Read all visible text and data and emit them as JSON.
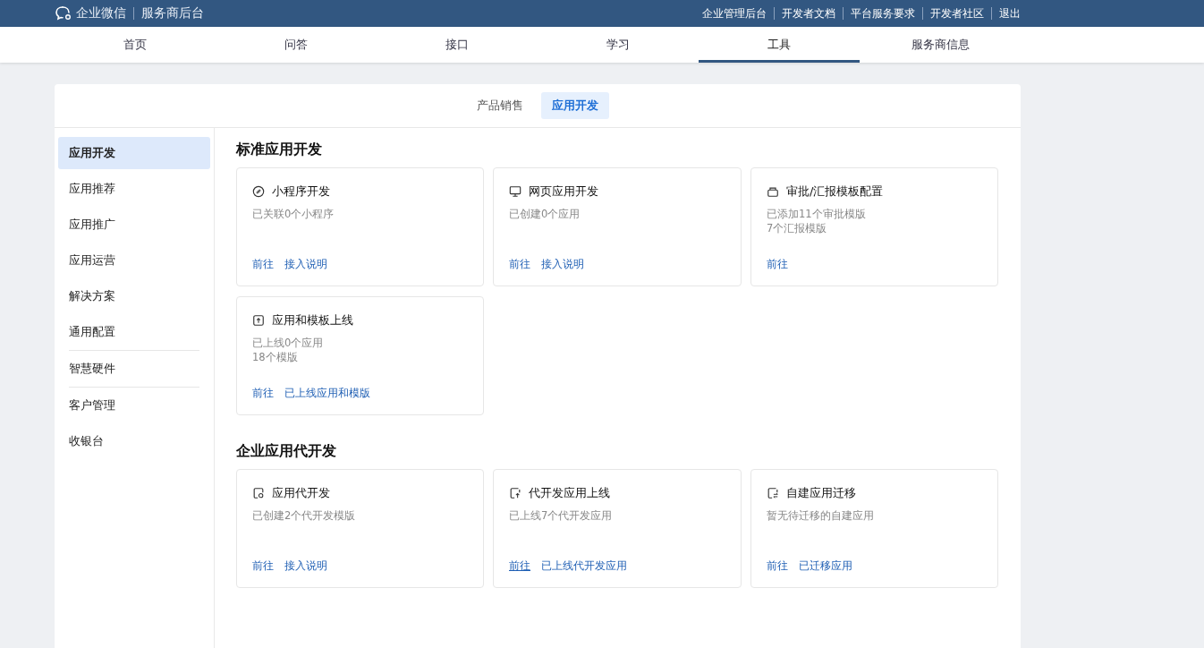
{
  "header": {
    "brand": "企业微信",
    "subtitle": "服务商后台",
    "links": [
      "企业管理后台",
      "开发者文档",
      "平台服务要求",
      "开发者社区",
      "退出"
    ]
  },
  "nav": [
    {
      "label": "首页",
      "selected": false
    },
    {
      "label": "问答",
      "selected": false
    },
    {
      "label": "接口",
      "selected": false
    },
    {
      "label": "学习",
      "selected": false
    },
    {
      "label": "工具",
      "selected": true
    },
    {
      "label": "服务商信息",
      "selected": false
    }
  ],
  "subtabs": [
    {
      "label": "产品销售",
      "selected": false
    },
    {
      "label": "应用开发",
      "selected": true
    }
  ],
  "sidebar": [
    {
      "label": "应用开发",
      "selected": true
    },
    {
      "label": "应用推荐",
      "selected": false
    },
    {
      "label": "应用推广",
      "selected": false
    },
    {
      "label": "应用运营",
      "selected": false
    },
    {
      "label": "解决方案",
      "selected": false
    },
    {
      "label": "通用配置",
      "selected": false
    },
    {
      "label": "智慧硬件",
      "selected": false
    },
    {
      "label": "客户管理",
      "selected": false
    },
    {
      "label": "收银台",
      "selected": false
    }
  ],
  "sections": [
    {
      "title": "标准应用开发",
      "cards": [
        {
          "title": "小程序开发",
          "desc": [
            "已关联0个小程序"
          ],
          "links": [
            {
              "text": "前往",
              "hovered": false
            },
            {
              "text": "接入说明",
              "hovered": false
            }
          ]
        },
        {
          "title": "网页应用开发",
          "desc": [
            "已创建0个应用"
          ],
          "links": [
            {
              "text": "前往",
              "hovered": false
            },
            {
              "text": "接入说明",
              "hovered": false
            }
          ]
        },
        {
          "title": "审批/汇报模板配置",
          "desc": [
            "已添加11个审批模版",
            "7个汇报模版"
          ],
          "links": [
            {
              "text": "前往",
              "hovered": false
            }
          ]
        },
        {
          "title": "应用和模板上线",
          "desc": [
            "已上线0个应用",
            "18个模版"
          ],
          "links": [
            {
              "text": "前往",
              "hovered": false
            },
            {
              "text": "已上线应用和模版",
              "hovered": false
            }
          ]
        }
      ]
    },
    {
      "title": "企业应用代开发",
      "cards": [
        {
          "title": "应用代开发",
          "desc": [
            "已创建2个代开发模版"
          ],
          "links": [
            {
              "text": "前往",
              "hovered": false
            },
            {
              "text": "接入说明",
              "hovered": false
            }
          ]
        },
        {
          "title": "代开发应用上线",
          "desc": [
            "已上线7个代开发应用"
          ],
          "links": [
            {
              "text": "前往",
              "hovered": true
            },
            {
              "text": "已上线代开发应用",
              "hovered": false
            }
          ]
        },
        {
          "title": "自建应用迁移",
          "desc": [
            "暂无待迁移的自建应用"
          ],
          "links": [
            {
              "text": "前往",
              "hovered": false
            },
            {
              "text": "已迁移应用",
              "hovered": false
            }
          ]
        }
      ]
    }
  ]
}
